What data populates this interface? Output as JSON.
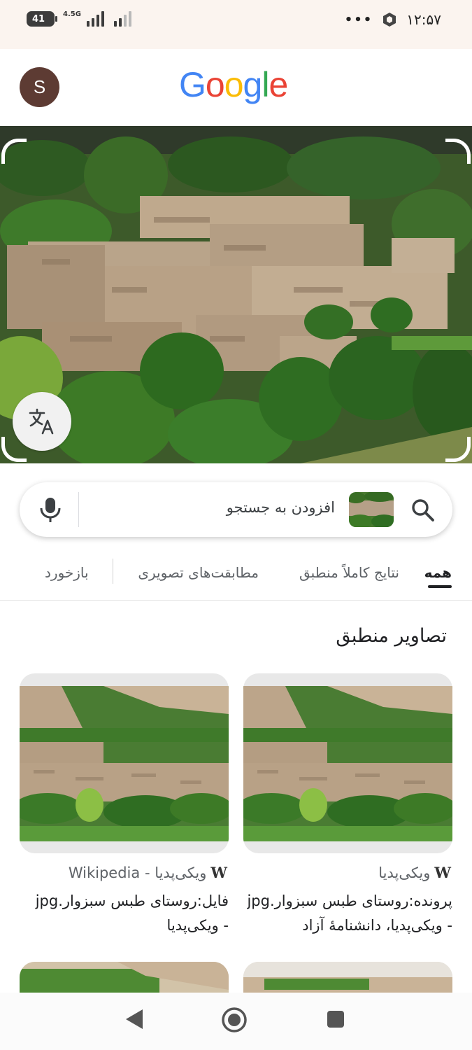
{
  "status_bar": {
    "battery": "41",
    "network": "4.5G",
    "time": "۱۲:۵۷",
    "more": "•••"
  },
  "header": {
    "avatar_letter": "S",
    "logo_text": "Google",
    "logo_colors": [
      "#4285F4",
      "#EA4335",
      "#FBBC05",
      "#4285F4",
      "#34A853",
      "#EA4335"
    ]
  },
  "search": {
    "placeholder": "افزودن به جستجو"
  },
  "tabs": [
    {
      "label": "همه",
      "active": true
    },
    {
      "label": "نتایج کاملاً منطبق",
      "active": false
    },
    {
      "label": "مطابقت‌های تصویری",
      "active": false
    },
    {
      "label": "بازخورد",
      "active": false
    }
  ],
  "section": {
    "title": "تصاویر منطبق"
  },
  "results": [
    {
      "source_logo": "W",
      "source": "ویکی‌پدیا",
      "title": "پرونده:روستای طبس سبزوار.jpg - ویکی‌پدیا، دانشنامهٔ آزاد"
    },
    {
      "source_logo": "W",
      "source": "ویکی‌پدیا - Wikipedia",
      "title": "فایل:روستای طبس سبزوار.jpg - ویکی‌پدیا"
    }
  ],
  "icons": {
    "mic": "microphone-icon",
    "search": "search-icon",
    "translate": "translate-icon",
    "back": "back-triangle-icon",
    "home": "home-circle-icon",
    "recents": "recents-square-icon"
  }
}
